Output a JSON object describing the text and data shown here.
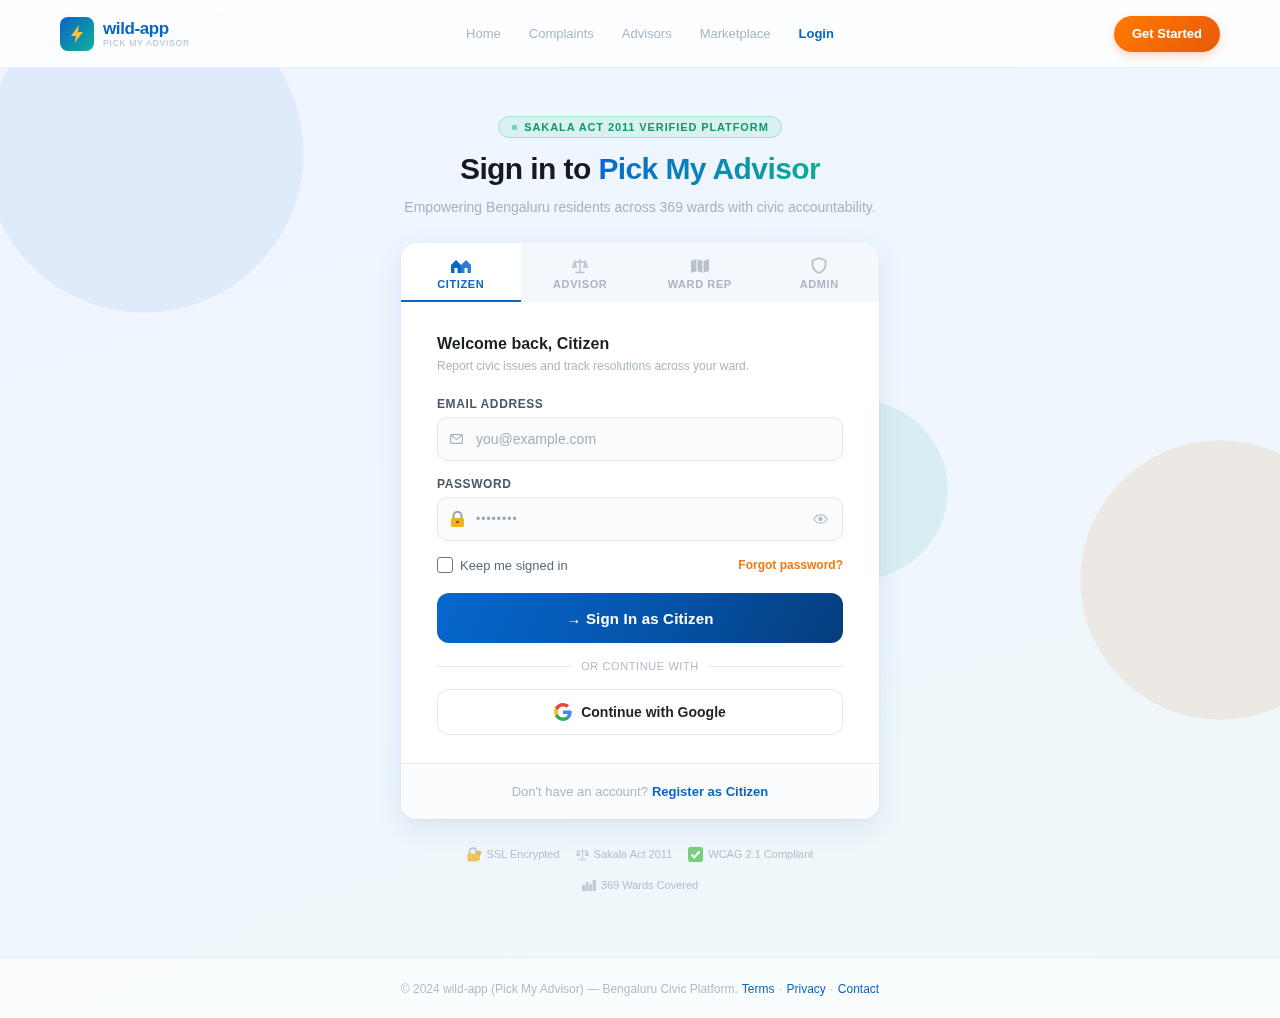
{
  "header": {
    "logo": {
      "name": "wild-app",
      "tagline": "PICK MY ADVISOR"
    },
    "nav": [
      {
        "label": "Home",
        "selected": false
      },
      {
        "label": "Complaints",
        "selected": false
      },
      {
        "label": "Advisors",
        "selected": false
      },
      {
        "label": "Marketplace",
        "selected": false
      },
      {
        "label": "Login",
        "selected": true
      }
    ],
    "cta": "Get Started"
  },
  "hero": {
    "badge": "SAKALA ACT 2011 VERIFIED PLATFORM",
    "title": "Sign in to",
    "title_highlight": "Pick My Advisor",
    "subtitle": "Empowering Bengaluru residents across 369 wards with civic accountability."
  },
  "login_card": {
    "tabs": [
      {
        "label": "CITIZEN",
        "selected": true
      },
      {
        "label": "ADVISOR",
        "selected": false
      },
      {
        "label": "WARD REP",
        "selected": false
      },
      {
        "label": "ADMIN",
        "selected": false
      }
    ],
    "heading": "Welcome back, Citizen",
    "description": "Report civic issues and track resolutions across your ward.",
    "email": {
      "label": "EMAIL ADDRESS",
      "placeholder": "you@example.com"
    },
    "password": {
      "label": "PASSWORD",
      "placeholder": "••••••••"
    },
    "remember": {
      "label": "Keep me signed in",
      "checked": false
    },
    "forgot_link": "Forgot password?",
    "submit": "→ Sign In as Citizen",
    "divider": "OR CONTINUE WITH",
    "google_button": "Continue with Google",
    "register_prompt": "Don't have an account?",
    "register_link": "Register as Citizen"
  },
  "trust_badges": [
    "SSL Encrypted",
    "Sakala Act 2011",
    "WCAG 2.1 Compliant",
    "369 Wards Covered"
  ],
  "footer": {
    "copyright": "© 2024 wild-app (Pick My Advisor) — Bengaluru Civic Platform.",
    "links": [
      "Terms",
      "Privacy",
      "Contact"
    ],
    "separator": "·"
  }
}
